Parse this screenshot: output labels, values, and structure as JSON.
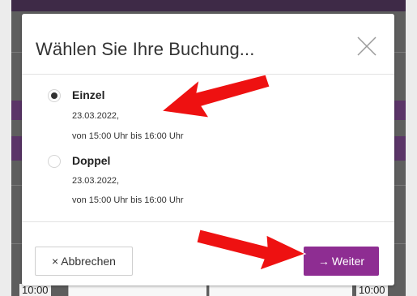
{
  "background": {
    "time_left": "10:00",
    "time_right": "10:00"
  },
  "modal": {
    "title": "Wählen Sie Ihre Buchung...",
    "close_icon": "close-icon",
    "options": [
      {
        "label": "Einzel",
        "date": "23.03.2022,",
        "time": "von 15:00 Uhr bis 16:00 Uhr",
        "selected": true
      },
      {
        "label": "Doppel",
        "date": "23.03.2022,",
        "time": "von 15:00 Uhr bis 16:00 Uhr",
        "selected": false
      }
    ],
    "footer": {
      "cancel_icon": "×",
      "cancel_label": "Abbrechen",
      "next_icon": "→",
      "next_label": "Weiter"
    }
  },
  "colors": {
    "accent": "#8e2d92",
    "annotation_arrow": "#ee1111",
    "bg_purple": "#5b3568"
  }
}
